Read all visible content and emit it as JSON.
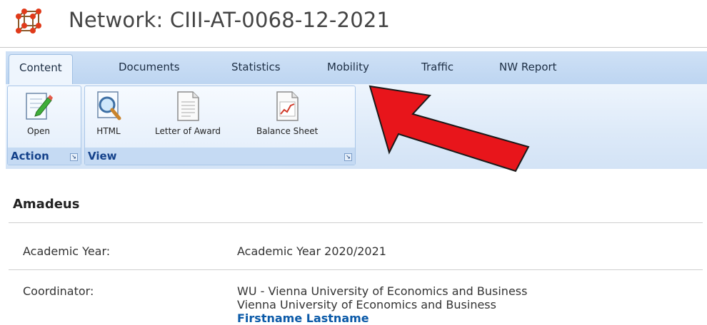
{
  "header": {
    "title": "Network: CIII-AT-0068-12-2021",
    "icon": "network-cube-icon"
  },
  "ribbon": {
    "tabs": [
      {
        "label": "Content",
        "active": true
      },
      {
        "label": "Documents",
        "active": false
      },
      {
        "label": "Statistics",
        "active": false
      },
      {
        "label": "Mobility",
        "active": false
      },
      {
        "label": "Traffic",
        "active": false
      },
      {
        "label": "NW Report",
        "active": false
      }
    ],
    "groups": {
      "action": {
        "label": "Action",
        "buttons": [
          {
            "label": "Open",
            "icon": "edit-document-icon"
          }
        ]
      },
      "view": {
        "label": "View",
        "buttons": [
          {
            "label": "HTML",
            "icon": "magnifier-document-icon"
          },
          {
            "label": "Letter of Award",
            "icon": "document-icon"
          },
          {
            "label": "Balance Sheet",
            "icon": "chart-document-icon"
          }
        ]
      }
    }
  },
  "annotation": {
    "color": "#e8151b",
    "icon": "red-arrow-annotation"
  },
  "details": {
    "section_title": "Amadeus",
    "rows": [
      {
        "label": "Academic Year:",
        "values": [
          "Academic Year 2020/2021"
        ]
      },
      {
        "label": "Coordinator:",
        "values": [
          "WU - Vienna University of Economics and Business",
          "Vienna University of Economics and Business"
        ],
        "link": "Firstname Lastname"
      }
    ]
  }
}
